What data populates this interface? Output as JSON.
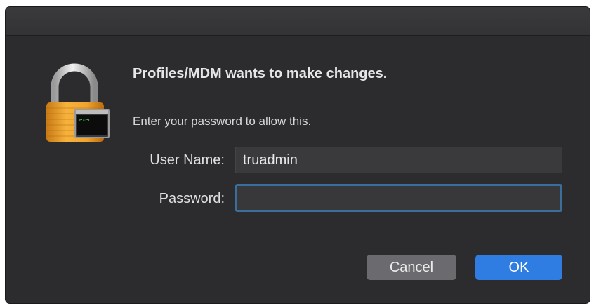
{
  "dialog": {
    "title": "Profiles/MDM wants to make changes.",
    "message": "Enter your password to allow this.",
    "lock_icon_label": "exec",
    "username_label": "User Name:",
    "username_value": "truadmin",
    "password_label": "Password:",
    "password_value": "",
    "cancel_label": "Cancel",
    "ok_label": "OK"
  },
  "colors": {
    "dialog_bg": "#2c2c2e",
    "ok_button": "#2f7de2",
    "cancel_button": "#6b6b6f",
    "focus_ring": "#3c6e9c",
    "lock_body": "#f0a830"
  },
  "icons": {
    "lock": "padlock-icon",
    "terminal": "terminal-exec-icon"
  }
}
